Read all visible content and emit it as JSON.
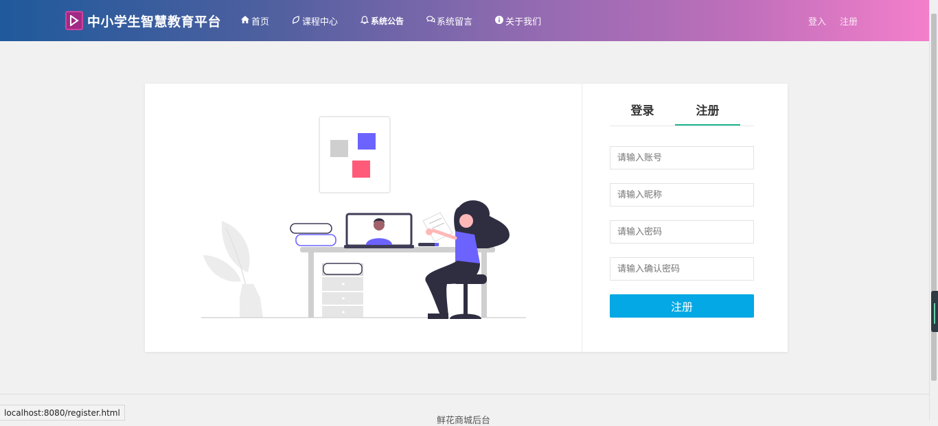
{
  "brand": {
    "title": "中小学生智慧教育平台",
    "logo_icon": "play-logo-icon",
    "logo_color": "#a02a86"
  },
  "nav": {
    "items": [
      {
        "label": "首页",
        "icon": "home-icon",
        "bold": false
      },
      {
        "label": "课程中心",
        "icon": "leaf-icon",
        "bold": false
      },
      {
        "label": "系统公告",
        "icon": "bell-icon",
        "bold": true
      },
      {
        "label": "系统留言",
        "icon": "comments-icon",
        "bold": false
      },
      {
        "label": "关于我们",
        "icon": "info-icon",
        "bold": false
      }
    ],
    "login": "登入",
    "register": "注册"
  },
  "form": {
    "tabs": [
      {
        "label": "登录",
        "active": false
      },
      {
        "label": "注册",
        "active": true
      }
    ],
    "fields": [
      {
        "placeholder": "请输入账号",
        "type": "text"
      },
      {
        "placeholder": "请输入昵称",
        "type": "text"
      },
      {
        "placeholder": "请输入密码",
        "type": "password"
      },
      {
        "placeholder": "请输入确认密码",
        "type": "password"
      }
    ],
    "submit_label": "注册",
    "accent_color": "#03a8e4",
    "tab_accent_color": "#1fb58f"
  },
  "footer": {
    "text": "鲜花商城后台"
  },
  "status_bar": {
    "url": "localhost:8080/register.html"
  }
}
